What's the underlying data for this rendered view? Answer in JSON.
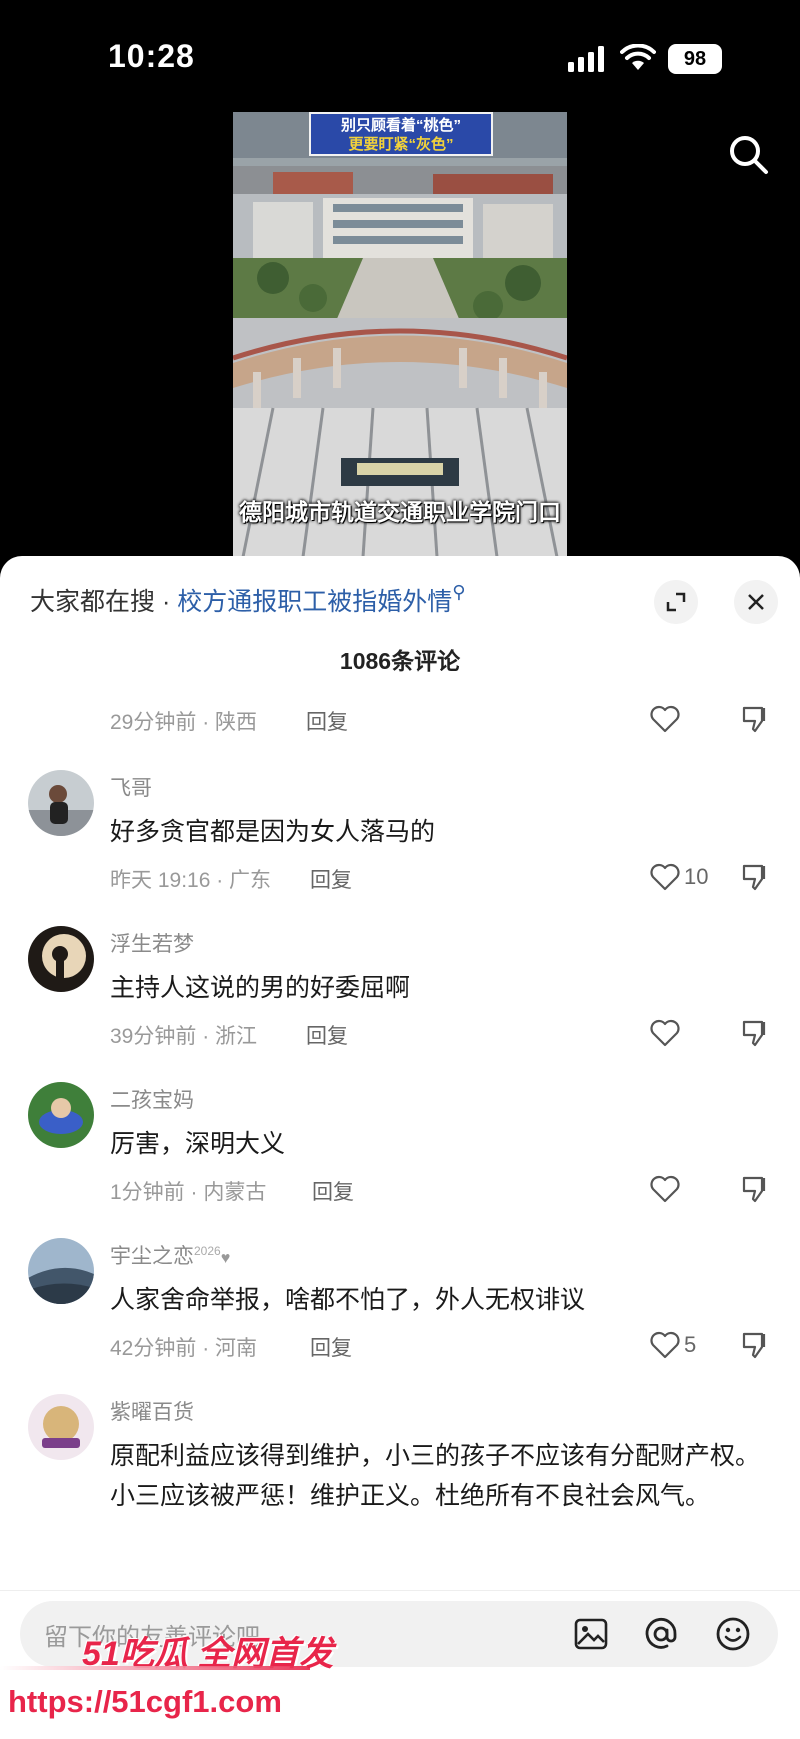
{
  "status_bar": {
    "time": "10:28",
    "battery": "98"
  },
  "video": {
    "banner_line1": "别只顾看着“桃色”",
    "banner_line2": "更要盯紧“灰色”",
    "caption": "德阳城市轨道交通职业学院门口"
  },
  "hot_search": {
    "prefix": "大家都在搜 · ",
    "term": "校方通报职工被指婚外情"
  },
  "comment_count": "1086条评论",
  "partial_comment": {
    "meta": "29分钟前 · 陕西",
    "reply": "回复"
  },
  "comments": [
    {
      "user": "飞哥",
      "text": "好多贪官都是因为女人落马的",
      "meta": "昨天 19:16 · 广东",
      "reply": "回复",
      "likes": "10"
    },
    {
      "user": "浮生若梦",
      "text": "主持人这说的男的好委屈啊",
      "meta": "39分钟前 · 浙江",
      "reply": "回复",
      "likes": ""
    },
    {
      "user": "二孩宝妈",
      "text": "厉害，深明大义",
      "meta": "1分钟前 · 内蒙古",
      "reply": "回复",
      "likes": ""
    },
    {
      "user": "宇尘之恋",
      "badge": "2026",
      "text": "人家舍命举报，啥都不怕了，外人无权诽议",
      "meta": "42分钟前 · 河南",
      "reply": "回复",
      "likes": "5"
    },
    {
      "user": "紫曜百货",
      "text": "原配利益应该得到维护，小三的孩子不应该有分配财产权。小三应该被严惩！维护正义。杜绝所有不良社会风气。"
    }
  ],
  "input": {
    "placeholder": "留下你的友善评论吧"
  },
  "watermark": {
    "brand": "51吃瓜 全网首发",
    "url": "https://51cgf1.com"
  },
  "colors": {
    "link": "#2d5fa8",
    "watermark": "#e8254a"
  }
}
